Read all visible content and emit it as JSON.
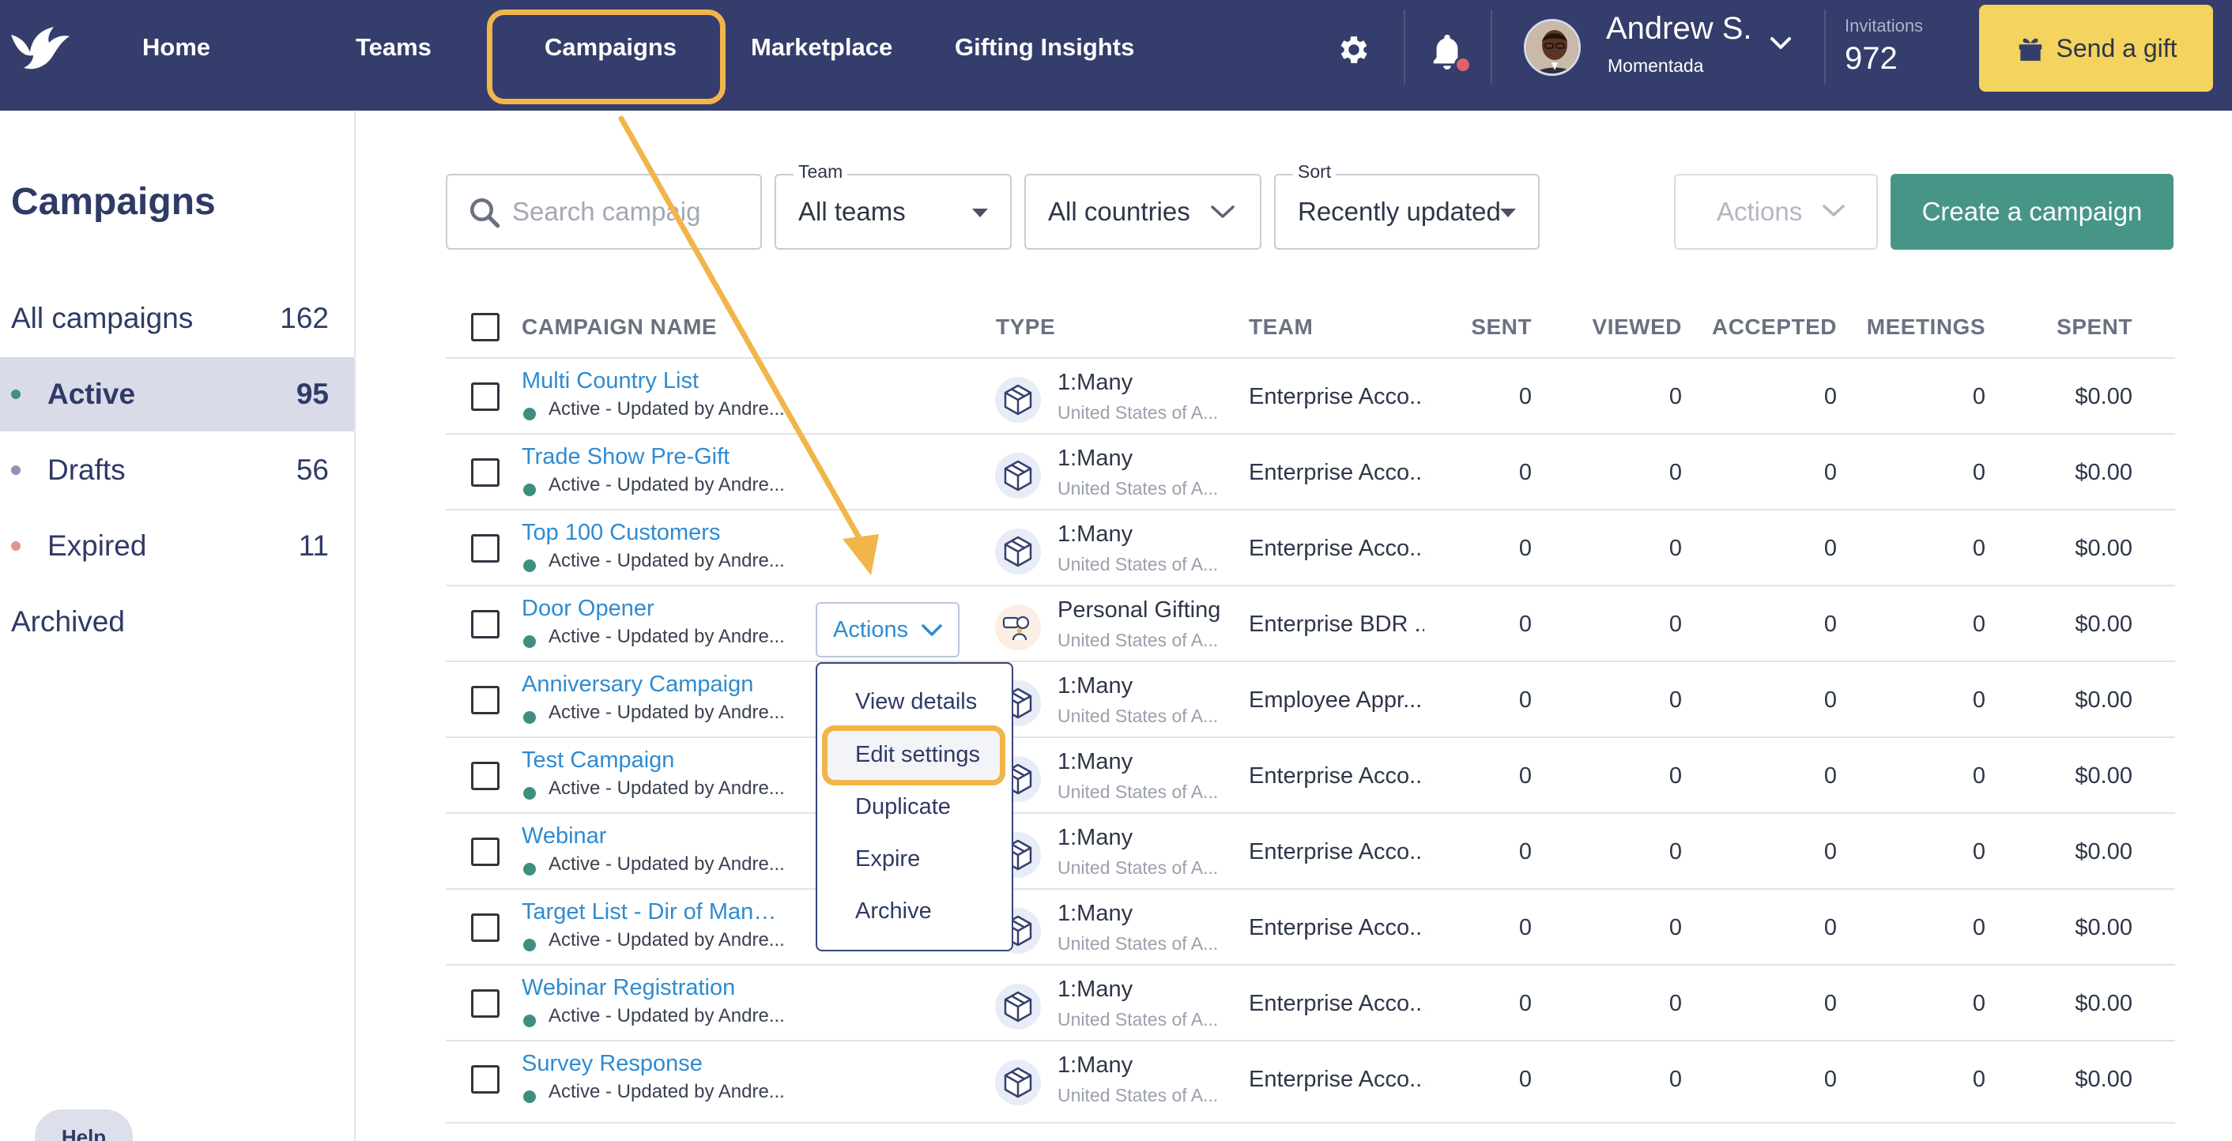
{
  "nav": {
    "items": [
      "Home",
      "Teams",
      "Campaigns",
      "Marketplace",
      "Gifting Insights"
    ],
    "highlighted": "Campaigns"
  },
  "user": {
    "name": "Andrew S.",
    "org": "Momentada"
  },
  "invitations": {
    "label": "Invitations",
    "value": "972"
  },
  "send_gift_label": "Send a gift",
  "sidebar": {
    "title": "Campaigns",
    "items": [
      {
        "label": "All campaigns",
        "count": "162",
        "dot": ""
      },
      {
        "label": "Active",
        "count": "95",
        "dot": "#3f8f80",
        "active": true
      },
      {
        "label": "Drafts",
        "count": "56",
        "dot": "#8e94b4"
      },
      {
        "label": "Expired",
        "count": "11",
        "dot": "#e39393"
      },
      {
        "label": "Archived",
        "count": "",
        "dot": ""
      }
    ],
    "help_label": "Help"
  },
  "filters": {
    "search_placeholder": "Search campaigns",
    "team": {
      "label": "Team",
      "value": "All teams"
    },
    "countries": {
      "value": "All countries"
    },
    "sort": {
      "label": "Sort",
      "value": "Recently updated"
    },
    "actions_label": "Actions",
    "create_label": "Create a campaign"
  },
  "table": {
    "headers": {
      "name": "CAMPAIGN NAME",
      "type": "TYPE",
      "team": "TEAM",
      "sent": "SENT",
      "viewed": "VIEWED",
      "accepted": "ACCEPTED",
      "meetings": "MEETINGS",
      "spent": "SPENT"
    },
    "rows": [
      {
        "name": "Multi Country List",
        "status": "Active - Updated by Andre...",
        "type": "1:Many",
        "country": "United States of A...",
        "team": "Enterprise Acco...",
        "sent": "0",
        "viewed": "0",
        "accepted": "0",
        "meetings": "0",
        "spent": "$0.00"
      },
      {
        "name": "Trade Show Pre-Gift",
        "status": "Active - Updated by Andre...",
        "type": "1:Many",
        "country": "United States of A...",
        "team": "Enterprise Acco...",
        "sent": "0",
        "viewed": "0",
        "accepted": "0",
        "meetings": "0",
        "spent": "$0.00"
      },
      {
        "name": "Top 100 Customers",
        "status": "Active - Updated by Andre...",
        "type": "1:Many",
        "country": "United States of A...",
        "team": "Enterprise Acco...",
        "sent": "0",
        "viewed": "0",
        "accepted": "0",
        "meetings": "0",
        "spent": "$0.00"
      },
      {
        "name": "Door Opener",
        "status": "Active - Updated by Andre...",
        "type": "Personal Gifting",
        "country": "United States of A...",
        "team": "Enterprise BDR ...",
        "sent": "0",
        "viewed": "0",
        "accepted": "0",
        "meetings": "0",
        "spent": "$0.00",
        "personal": true
      },
      {
        "name": "Anniversary Campaign",
        "status": "Active - Updated by Andre...",
        "type": "1:Many",
        "country": "United States of A...",
        "team": "Employee Appr...",
        "sent": "0",
        "viewed": "0",
        "accepted": "0",
        "meetings": "0",
        "spent": "$0.00"
      },
      {
        "name": "Test Campaign",
        "status": "Active - Updated by Andre...",
        "type": "1:Many",
        "country": "United States of A...",
        "team": "Enterprise Acco...",
        "sent": "0",
        "viewed": "0",
        "accepted": "0",
        "meetings": "0",
        "spent": "$0.00"
      },
      {
        "name": "Webinar",
        "status": "Active - Updated by Andre...",
        "type": "1:Many",
        "country": "United States of A...",
        "team": "Enterprise Acco...",
        "sent": "0",
        "viewed": "0",
        "accepted": "0",
        "meetings": "0",
        "spent": "$0.00"
      },
      {
        "name": "Target List - Dir of Manuf...",
        "status": "Active - Updated by Andre...",
        "type": "1:Many",
        "country": "United States of A...",
        "team": "Enterprise Acco...",
        "sent": "0",
        "viewed": "0",
        "accepted": "0",
        "meetings": "0",
        "spent": "$0.00"
      },
      {
        "name": "Webinar Registration",
        "status": "Active - Updated by Andre...",
        "type": "1:Many",
        "country": "United States of A...",
        "team": "Enterprise Acco...",
        "sent": "0",
        "viewed": "0",
        "accepted": "0",
        "meetings": "0",
        "spent": "$0.00"
      },
      {
        "name": "Survey Response",
        "status": "Active - Updated by Andre...",
        "type": "1:Many",
        "country": "United States of A...",
        "team": "Enterprise Acco...",
        "sent": "0",
        "viewed": "0",
        "accepted": "0",
        "meetings": "0",
        "spent": "$0.00"
      }
    ]
  },
  "row_actions": {
    "label": "Actions",
    "menu": [
      "View details",
      "Edit settings",
      "Duplicate",
      "Expire",
      "Archive"
    ],
    "highlighted": "Edit settings"
  },
  "colors": {
    "nav_bg": "#343d6b",
    "highlight": "#f1b54a",
    "send_gift_bg": "#f4d35e",
    "create_bg": "#479587",
    "link": "#2f8bd0",
    "active_dot": "#3f8f80"
  },
  "icons": [
    "dove-logo-icon",
    "gear-icon",
    "bell-icon",
    "chevron-down-icon",
    "gift-icon",
    "search-icon",
    "box-icon",
    "personal-gifting-icon"
  ]
}
